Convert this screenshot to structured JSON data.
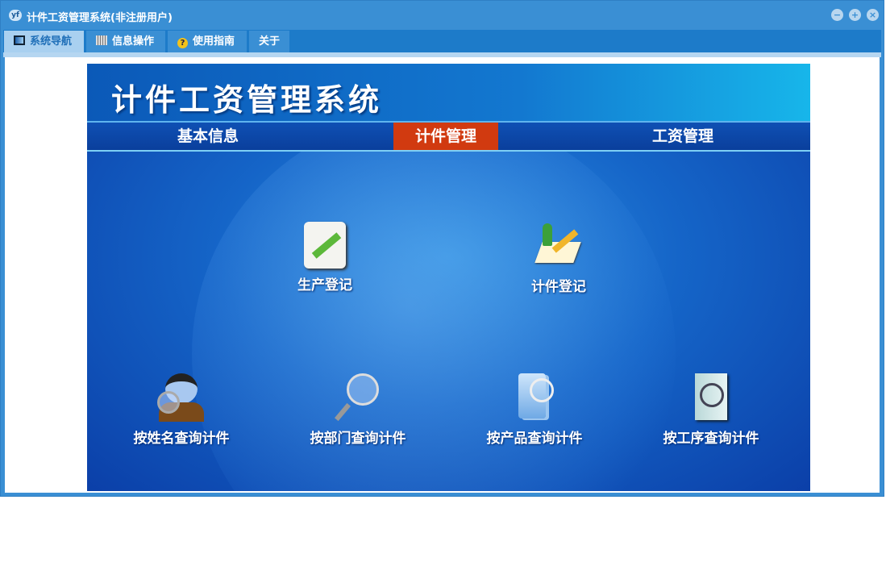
{
  "window": {
    "title": "计件工资管理系统(非注册用户)",
    "logo": "yf"
  },
  "tabs": [
    {
      "label": "系统导航",
      "icon": "monitor-icon"
    },
    {
      "label": "信息操作",
      "icon": "grid-icon"
    },
    {
      "label": "使用指南",
      "icon": "help-icon"
    },
    {
      "label": "关于"
    }
  ],
  "banner": {
    "title": "计件工资管理系统"
  },
  "nav": [
    {
      "label": "基本信息"
    },
    {
      "label": "计件管理"
    },
    {
      "label": "工资管理"
    }
  ],
  "items": [
    {
      "label": "生产登记",
      "icon": "notepad-pencil-icon"
    },
    {
      "label": "计件登记",
      "icon": "register-icon"
    },
    {
      "label": "按姓名查询计件",
      "icon": "person-search-icon"
    },
    {
      "label": "按部门查询计件",
      "icon": "magnifier-icon"
    },
    {
      "label": "按产品查询计件",
      "icon": "documents-search-icon"
    },
    {
      "label": "按工序查询计件",
      "icon": "document-search-icon"
    }
  ],
  "colors": {
    "accent": "#3a8fd4",
    "active_nav": "#d13a10"
  }
}
